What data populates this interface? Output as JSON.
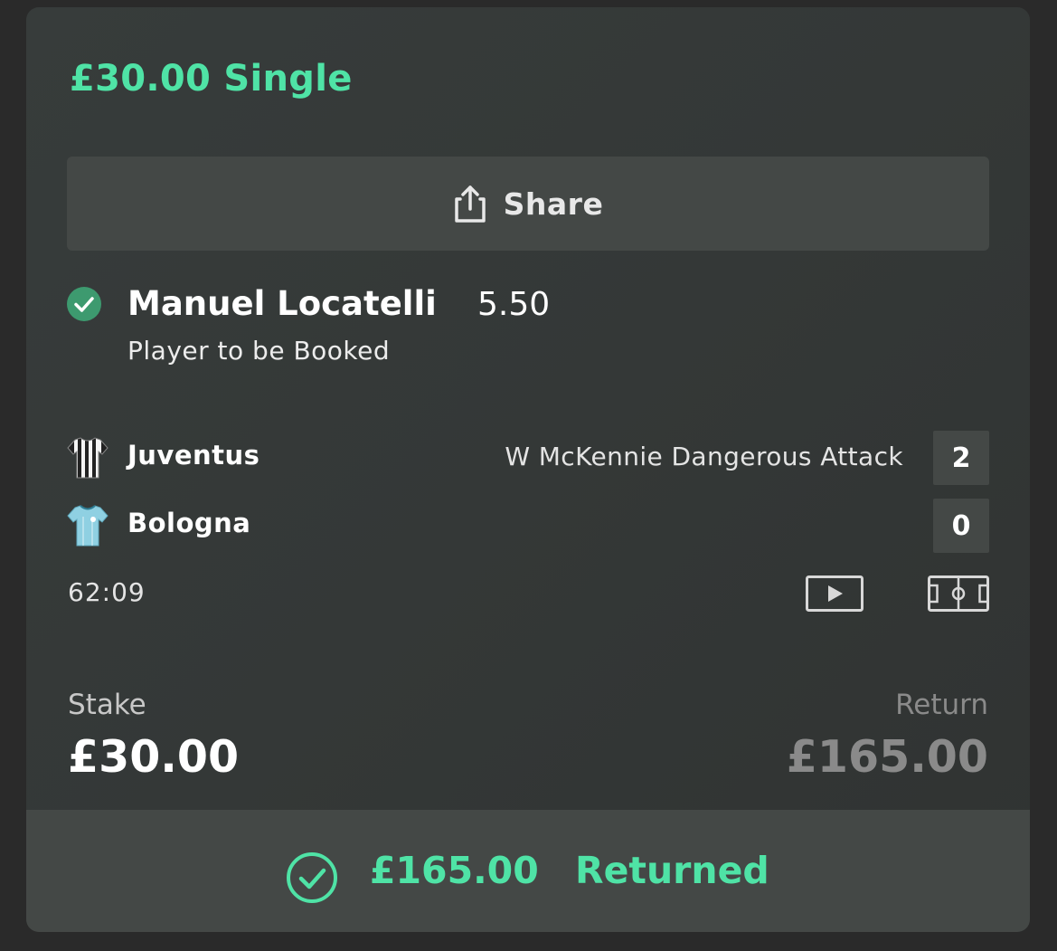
{
  "bet": {
    "title": "£30.00 Single",
    "share_label": "Share"
  },
  "selection": {
    "name": "Manuel Locatelli",
    "odds": "5.50",
    "market": "Player to be Booked",
    "status_icon": "check-circle-icon"
  },
  "match": {
    "home": {
      "name": "Juventus",
      "score": "2",
      "event": "W McKennie Dangerous Attack",
      "kit": "black-white-stripes-shirt-icon"
    },
    "away": {
      "name": "Bologna",
      "score": "0",
      "event": "",
      "kit": "light-blue-shirt-icon"
    },
    "clock": "62:09",
    "icons": [
      "play-stream-icon",
      "pitch-tracker-icon"
    ]
  },
  "summary": {
    "stake_label": "Stake",
    "stake_value": "£30.00",
    "return_label": "Return",
    "return_value": "£165.00"
  },
  "footer": {
    "amount": "£165.00",
    "status": "Returned"
  },
  "colors": {
    "accent": "#4fe3a6",
    "card_bg": "#353938",
    "button_bg": "#444846",
    "muted": "#8a8a8a",
    "check_fill": "#3d9a6f"
  }
}
